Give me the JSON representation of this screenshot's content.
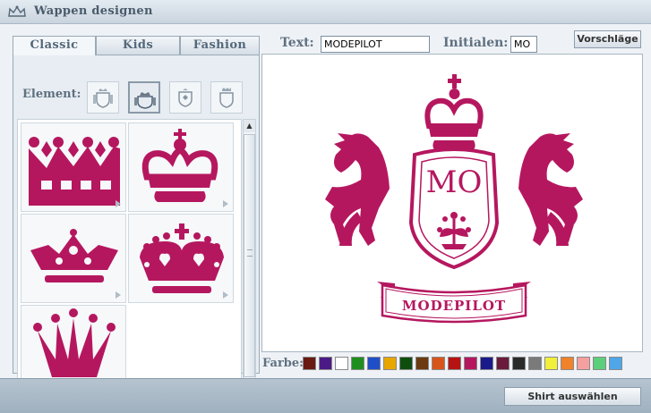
{
  "window": {
    "title": "Wappen designen"
  },
  "tabs": [
    {
      "label": "Classic",
      "active": true
    },
    {
      "label": "Kids",
      "active": false
    },
    {
      "label": "Fashion",
      "active": false
    }
  ],
  "element_selector": {
    "label": "Element:",
    "options": [
      "shield-crown-icon",
      "crown-icon",
      "shield-emblem-icon",
      "castle-shield-icon"
    ],
    "selected": "crown-icon"
  },
  "crowns": [
    {
      "name": "crown-zigzag-icon"
    },
    {
      "name": "crown-royal-icon"
    },
    {
      "name": "crown-flat-icon"
    },
    {
      "name": "crown-heart-icon"
    },
    {
      "name": "crown-ball-icon"
    }
  ],
  "text_field": {
    "label": "Text:",
    "value": "MODEPILOT"
  },
  "initials_field": {
    "label": "Initialen:",
    "value": "MO"
  },
  "suggest_button": {
    "label": "Vorschläge"
  },
  "preview": {
    "initials": "MO",
    "banner_text": "MODEPILOT",
    "color": "#b5175f"
  },
  "colors": {
    "label": "Farbe:",
    "swatches": [
      "#6a1a10",
      "#4b1a86",
      "#ffffff",
      "#1e8f1e",
      "#1f4fc8",
      "#e8a600",
      "#0f4d0f",
      "#6b3a10",
      "#d8551a",
      "#b81313",
      "#b5175f",
      "#1a1a8a",
      "#6a1a3a",
      "#2a2a2a",
      "#7a7a7a",
      "#f2ef3a",
      "#f0822a",
      "#f5a0a0",
      "#5ccf7a",
      "#4fa6e8"
    ],
    "selected": "#b5175f"
  },
  "footer": {
    "button_label": "Shirt auswählen"
  }
}
